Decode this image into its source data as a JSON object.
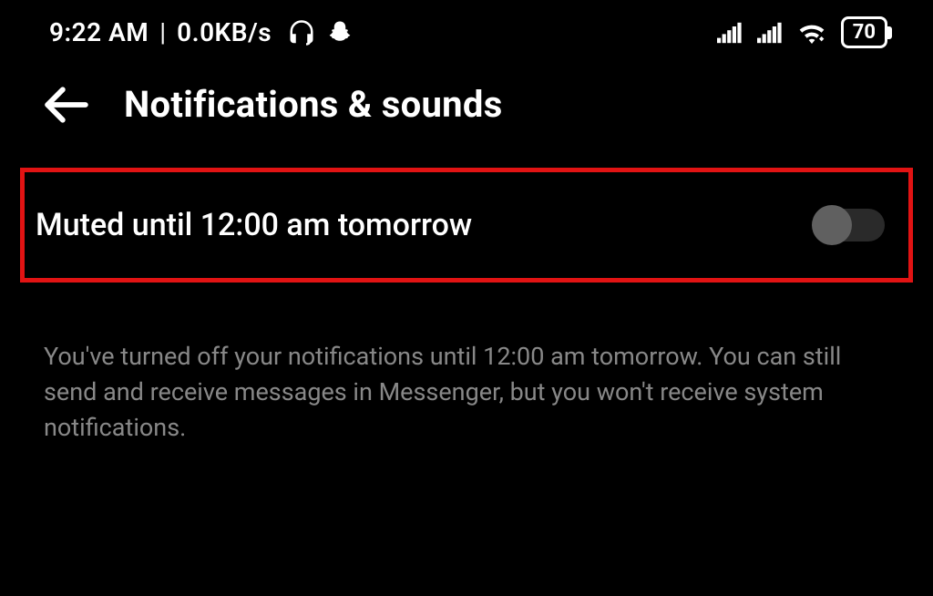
{
  "status": {
    "time": "9:22 AM",
    "separator": "|",
    "data_rate": "0.0KB/s",
    "battery": "70"
  },
  "header": {
    "title": "Notifications & sounds"
  },
  "setting": {
    "label": "Muted until 12:00 am tomorrow"
  },
  "description": "You've turned off your notifications until 12:00 am tomorrow. You can still send and receive messages in Messenger, but you won't receive system notifications."
}
